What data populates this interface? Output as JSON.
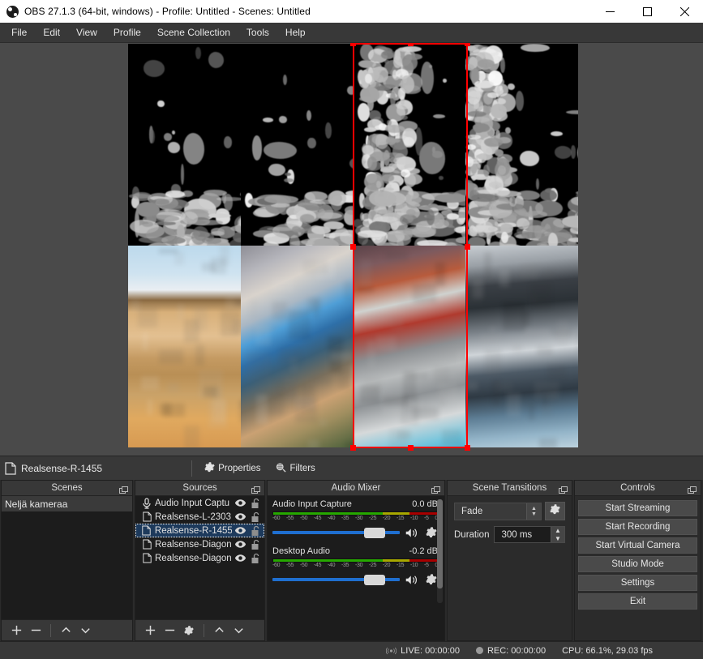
{
  "window": {
    "title": "OBS 27.1.3 (64-bit, windows) - Profile: Untitled - Scenes: Untitled",
    "logo_icon": "obs-logo-icon",
    "minimize_icon": "minimize-icon",
    "maximize_icon": "maximize-icon",
    "close_icon": "close-icon"
  },
  "menubar": {
    "items": [
      {
        "label": "File"
      },
      {
        "label": "Edit"
      },
      {
        "label": "View"
      },
      {
        "label": "Profile"
      },
      {
        "label": "Scene Collection"
      },
      {
        "label": "Tools"
      },
      {
        "label": "Help"
      }
    ]
  },
  "source_toolbar": {
    "file_icon": "file-icon",
    "selected_source": "Realsense-R-1455",
    "properties_label": "Properties",
    "properties_icon": "gear-icon",
    "filters_label": "Filters",
    "filters_icon": "filters-icon"
  },
  "scenes": {
    "title": "Scenes",
    "float_icon": "undock-icon",
    "items": [
      {
        "label": "Neljä kameraa",
        "selected": true
      }
    ],
    "footer": [
      {
        "icon": "plus-icon",
        "name": "add-scene-button"
      },
      {
        "icon": "minus-icon",
        "name": "remove-scene-button"
      },
      {
        "icon": "chevron-up-icon",
        "name": "move-scene-up-button"
      },
      {
        "icon": "chevron-down-icon",
        "name": "move-scene-down-button"
      }
    ]
  },
  "sources": {
    "title": "Sources",
    "float_icon": "undock-icon",
    "items": [
      {
        "label": "Audio Input Captu",
        "icon": "microphone-icon",
        "visible": true,
        "locked": false,
        "selected": false
      },
      {
        "label": "Realsense-L-2303",
        "icon": "file-icon",
        "visible": true,
        "locked": false,
        "selected": false
      },
      {
        "label": "Realsense-R-1455",
        "icon": "file-icon",
        "visible": true,
        "locked": false,
        "selected": true
      },
      {
        "label": "Realsense-Diagon",
        "icon": "file-icon",
        "visible": true,
        "locked": false,
        "selected": false
      },
      {
        "label": "Realsense-Diagon",
        "icon": "file-icon",
        "visible": true,
        "locked": false,
        "selected": false
      }
    ],
    "footer": [
      {
        "icon": "plus-icon",
        "name": "add-source-button"
      },
      {
        "icon": "minus-icon",
        "name": "remove-source-button"
      },
      {
        "icon": "gear-icon",
        "name": "source-properties-button"
      },
      {
        "icon": "chevron-up-icon",
        "name": "move-source-up-button"
      },
      {
        "icon": "chevron-down-icon",
        "name": "move-source-down-button"
      }
    ]
  },
  "audio_mixer": {
    "title": "Audio Mixer",
    "float_icon": "undock-icon",
    "tick_labels": [
      "-60",
      "-55",
      "-50",
      "-45",
      "-40",
      "-35",
      "-30",
      "-25",
      "-20",
      "-15",
      "-10",
      "-5",
      "0"
    ],
    "channels": [
      {
        "name": "Audio Input Capture",
        "db": "0.0 dB",
        "volume_percent": 80,
        "mute_icon": "speaker-icon",
        "config_icon": "gear-icon"
      },
      {
        "name": "Desktop Audio",
        "db": "-0.2 dB",
        "volume_percent": 80,
        "mute_icon": "speaker-icon",
        "config_icon": "gear-icon"
      }
    ]
  },
  "scene_transitions": {
    "title": "Scene Transitions",
    "float_icon": "undock-icon",
    "transition": "Fade",
    "transition_options": [
      "Fade"
    ],
    "config_icon": "gear-icon",
    "duration_label": "Duration",
    "duration_value": "300 ms"
  },
  "controls": {
    "title": "Controls",
    "float_icon": "undock-icon",
    "buttons": [
      {
        "label": "Start Streaming",
        "name": "start-streaming-button"
      },
      {
        "label": "Start Recording",
        "name": "start-recording-button"
      },
      {
        "label": "Start Virtual Camera",
        "name": "start-virtual-camera-button"
      },
      {
        "label": "Studio Mode",
        "name": "studio-mode-button"
      },
      {
        "label": "Settings",
        "name": "settings-button"
      },
      {
        "label": "Exit",
        "name": "exit-button"
      }
    ]
  },
  "statusbar": {
    "live_icon": "broadcast-icon",
    "live_text": "LIVE: 00:00:00",
    "rec_icon": "record-dot-icon",
    "rec_text": "REC: 00:00:00",
    "cpu_text": "CPU: 66.1%, 29.03 fps"
  },
  "preview": {
    "selection_color": "#ff0000",
    "background_color": "#4a4a4a",
    "canvas_background": "#000000",
    "tiles": [
      {
        "name": "depth-view-left",
        "type": "depth"
      },
      {
        "name": "depth-view-center-left",
        "type": "depth"
      },
      {
        "name": "depth-view-center-right",
        "type": "depth",
        "selected": true
      },
      {
        "name": "depth-view-right",
        "type": "depth"
      },
      {
        "name": "rgb-view-left",
        "type": "rgb"
      },
      {
        "name": "rgb-view-center-left",
        "type": "rgb"
      },
      {
        "name": "rgb-view-center-right",
        "type": "rgb",
        "selected": true
      },
      {
        "name": "rgb-view-right",
        "type": "rgb"
      }
    ]
  }
}
